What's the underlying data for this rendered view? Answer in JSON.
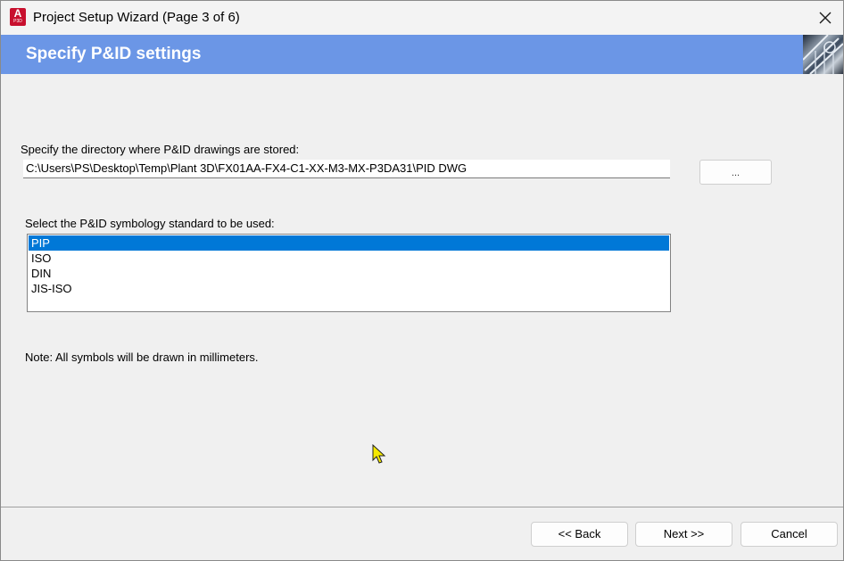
{
  "window": {
    "title": "Project Setup Wizard (Page 3 of 6)",
    "app_icon_letter": "A",
    "app_icon_sub": "P3D"
  },
  "banner": {
    "title": "Specify P&ID settings"
  },
  "directory": {
    "label": "Specify the directory where P&ID drawings are stored:",
    "value": "C:\\Users\\PS\\Desktop\\Temp\\Plant 3D\\FX01AA-FX4-C1-XX-M3-MX-P3DA31\\PID DWG",
    "browse_label": "..."
  },
  "symbology": {
    "label": "Select the P&ID symbology standard to be used:",
    "options": [
      "PIP",
      "ISO",
      "DIN",
      "JIS-ISO"
    ],
    "selected": "PIP"
  },
  "note": "Note: All symbols will be drawn in millimeters.",
  "buttons": {
    "back": "<< Back",
    "next": "Next >>",
    "cancel": "Cancel"
  },
  "colors": {
    "banner": "#6b96e6",
    "selection": "#0078d7",
    "app_icon": "#c8102e"
  }
}
